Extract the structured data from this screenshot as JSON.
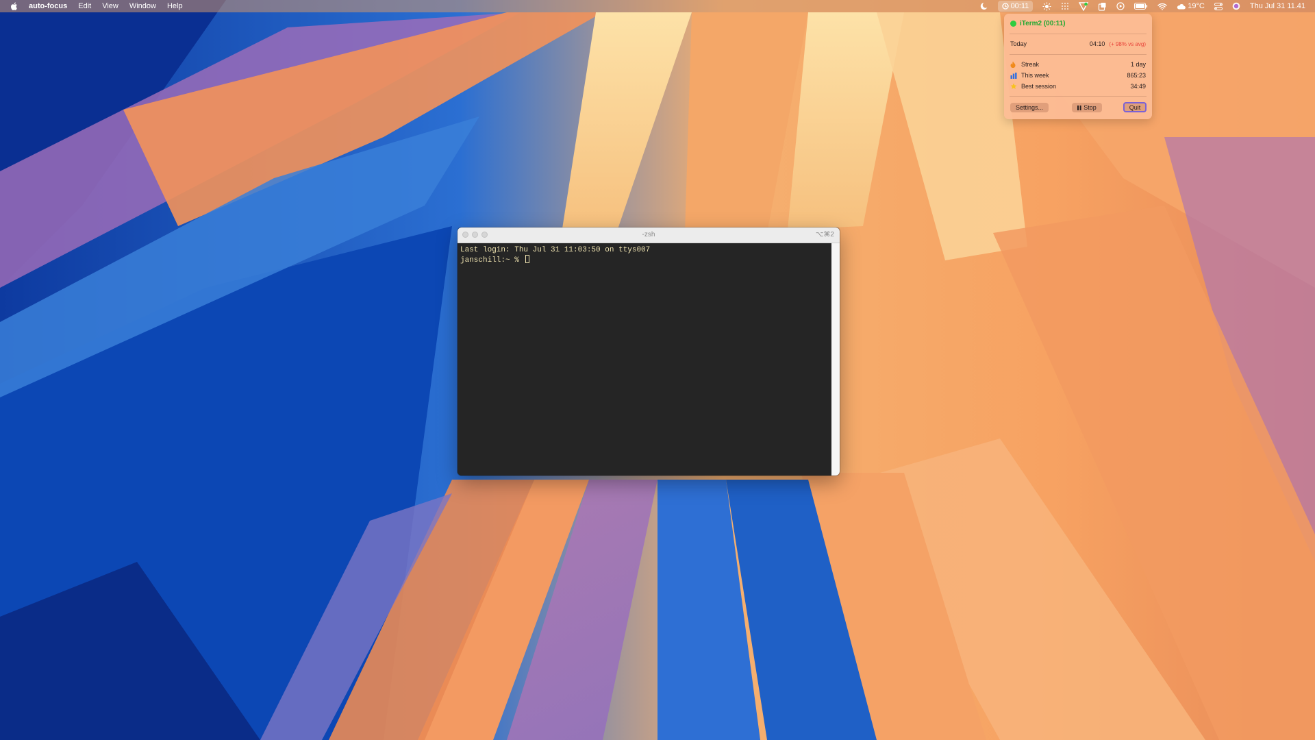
{
  "menubar": {
    "app_name": "auto-focus",
    "menus": [
      "Edit",
      "View",
      "Window",
      "Help"
    ],
    "focus_timer": "00:11",
    "temperature": "19°C",
    "datetime": "Thu Jul 31  11.41",
    "status_icons": [
      "moon-icon",
      "focus-timer-icon",
      "brightness-icon",
      "grid-icon",
      "vpn-icon",
      "clipboard-icon",
      "play-icon",
      "battery-icon",
      "wifi-icon",
      "weather-icon",
      "control-center-icon",
      "siri-icon"
    ]
  },
  "popover": {
    "app_title": "iTerm2 (00:11)",
    "today_label": "Today",
    "today_value": "04:10",
    "today_delta": "(+ 98% vs avg)",
    "stats": [
      {
        "label": "Streak",
        "value": "1 day",
        "icon": "flame-icon"
      },
      {
        "label": "This week",
        "value": "865:23",
        "icon": "bar-chart-icon"
      },
      {
        "label": "Best session",
        "value": "34:49",
        "icon": "star-icon"
      }
    ],
    "buttons": {
      "settings": "Settings...",
      "stop": "Stop",
      "quit": "Quit"
    },
    "colors": {
      "active": "#2ecc40",
      "delta": "#e8443a",
      "quit_outline": "#7b62d6"
    }
  },
  "terminal": {
    "title": "-zsh",
    "shortcut": "⌥⌘2",
    "lines": [
      "Last login: Thu Jul 31 11:03:50 on ttys007",
      "janschill:~ % "
    ]
  }
}
